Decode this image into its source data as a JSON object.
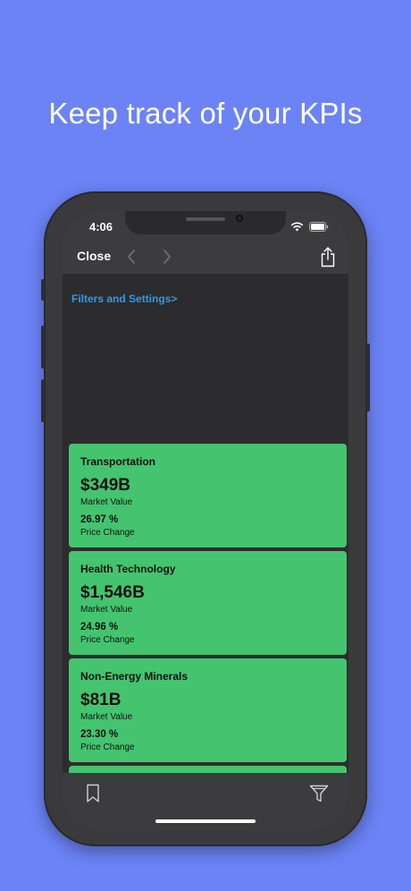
{
  "promo": {
    "headline": "Keep track of your KPIs"
  },
  "statusbar": {
    "time": "4:06"
  },
  "navbar": {
    "close_label": "Close"
  },
  "content": {
    "filters_link": "Filters and Settings>"
  },
  "cards": [
    {
      "title": "Transportation",
      "value": "$349B",
      "value_label": "Market Value",
      "change": "26.97 %",
      "change_label": "Price Change"
    },
    {
      "title": "Health Technology",
      "value": "$1,546B",
      "value_label": "Market Value",
      "change": "24.96 %",
      "change_label": "Price Change"
    },
    {
      "title": "Non-Energy Minerals",
      "value": "$81B",
      "value_label": "Market Value",
      "change": "23.30 %",
      "change_label": "Price Change"
    }
  ],
  "icons": {
    "back": "chevron-left-icon",
    "forward": "chevron-right-icon",
    "share": "share-icon",
    "bookmark": "bookmark-icon",
    "filter": "filter-icon"
  },
  "colors": {
    "background": "#6c83f6",
    "card": "#44c46f",
    "link": "#2e9ae6",
    "screen": "#2c2c2e",
    "bars": "#3c3c3e"
  }
}
